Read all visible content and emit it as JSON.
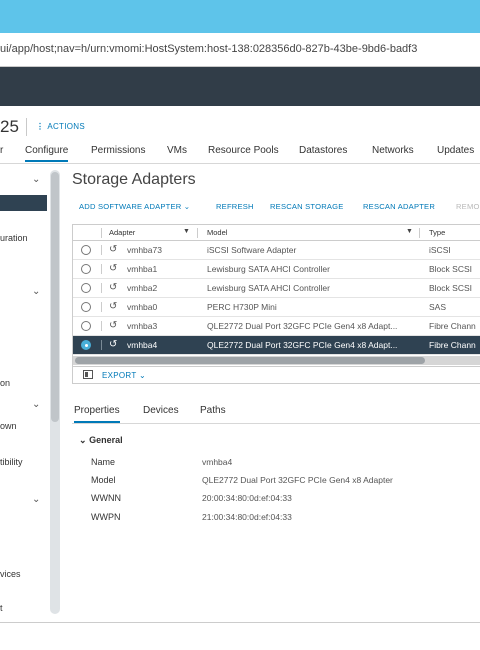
{
  "browser": {
    "url": "ui/app/host;nav=h/urn:vmomi:HostSystem:host-138:028356d0-827b-43be-9bd6-badf3"
  },
  "host": {
    "name_fragment": "25",
    "actions_label": "ACTIONS"
  },
  "tabs": [
    "r",
    "Configure",
    "Permissions",
    "VMs",
    "Resource Pools",
    "Datastores",
    "Networks",
    "Updates"
  ],
  "sidebar": {
    "items": [
      "uration",
      "on",
      "own",
      "tibility",
      "vices",
      "t"
    ]
  },
  "panel": {
    "title": "Storage Adapters",
    "toolbar": {
      "add": "ADD SOFTWARE ADAPTER",
      "refresh": "REFRESH",
      "rescan_storage": "RESCAN STORAGE",
      "rescan_adapter": "RESCAN ADAPTER",
      "remove": "REMO"
    },
    "columns": {
      "adapter": "Adapter",
      "model": "Model",
      "type": "Type"
    },
    "rows": [
      {
        "adapter": "vmhba73",
        "model": "iSCSI Software Adapter",
        "type": "iSCSI",
        "selected": false
      },
      {
        "adapter": "vmhba1",
        "model": "Lewisburg SATA AHCI Controller",
        "type": "Block SCSI",
        "selected": false
      },
      {
        "adapter": "vmhba2",
        "model": "Lewisburg SATA AHCI Controller",
        "type": "Block SCSI",
        "selected": false
      },
      {
        "adapter": "vmhba0",
        "model": "PERC H730P Mini",
        "type": "SAS",
        "selected": false
      },
      {
        "adapter": "vmhba3",
        "model": "QLE2772 Dual Port 32GFC PCIe Gen4 x8 Adapt...",
        "type": "Fibre Chann",
        "selected": false
      },
      {
        "adapter": "vmhba4",
        "model": "QLE2772 Dual Port 32GFC PCIe Gen4 x8 Adapt...",
        "type": "Fibre Chann",
        "selected": true
      }
    ],
    "export_label": "EXPORT"
  },
  "details": {
    "tabs": [
      "Properties",
      "Devices",
      "Paths"
    ],
    "section": "General",
    "properties": [
      {
        "label": "Name",
        "value": "vmhba4"
      },
      {
        "label": "Model",
        "value": "QLE2772 Dual Port 32GFC PCIe Gen4 x8 Adapter"
      },
      {
        "label": "WWNN",
        "value": "20:00:34:80:0d:ef:04:33"
      },
      {
        "label": "WWPN",
        "value": "21:00:34:80:0d:ef:04:33"
      }
    ]
  },
  "colors": {
    "titlebar": "#5ec4ea",
    "app_header": "#313d48",
    "selected_row": "#2f4252",
    "link": "#0079b8"
  }
}
